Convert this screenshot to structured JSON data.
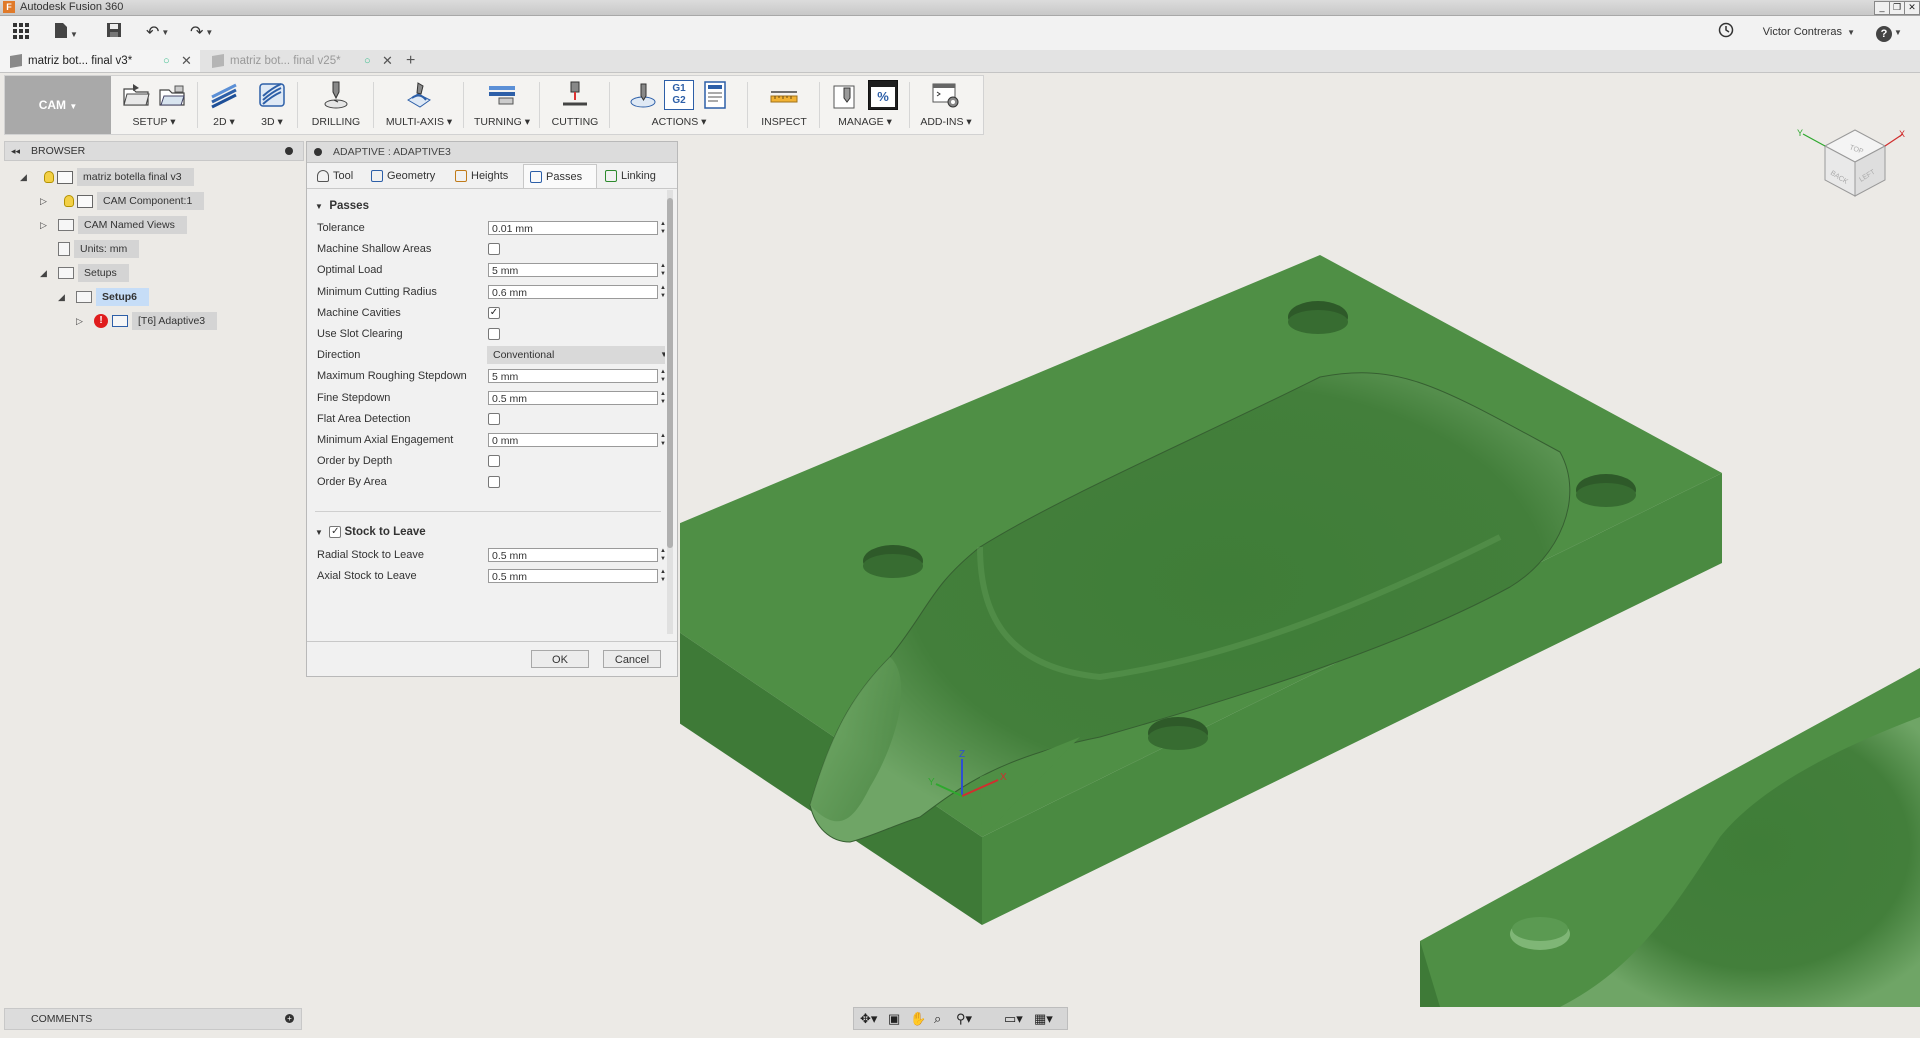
{
  "app": {
    "title": "Autodesk Fusion 360",
    "logo_letter": "F",
    "user": "Victor Contreras",
    "help_label": "?"
  },
  "tabs": [
    {
      "label": "matriz bot... final v3*",
      "active": true
    },
    {
      "label": "matriz bot... final v25*",
      "active": false
    }
  ],
  "ribbon": {
    "workspace": "CAM",
    "groups": [
      {
        "label": "SETUP",
        "caret": true,
        "icons": [
          "setup-folder-icon",
          "setup-sheet-icon"
        ]
      },
      {
        "label": "2D",
        "caret": true,
        "icons": [
          "toolpath-2d-icon"
        ]
      },
      {
        "label": "3D",
        "caret": true,
        "icons": [
          "toolpath-3d-icon"
        ]
      },
      {
        "label": "DRILLING",
        "caret": false,
        "icons": [
          "drill-icon"
        ]
      },
      {
        "label": "MULTI-AXIS",
        "caret": true,
        "icons": [
          "multi-axis-icon"
        ]
      },
      {
        "label": "TURNING",
        "caret": true,
        "icons": [
          "turning-icon"
        ]
      },
      {
        "label": "CUTTING",
        "caret": false,
        "icons": [
          "cutting-icon"
        ]
      },
      {
        "label": "ACTIONS",
        "caret": true,
        "icons": [
          "simulate-icon",
          "post-process-icon",
          "setup-sheet-doc-icon"
        ]
      },
      {
        "label": "INSPECT",
        "caret": false,
        "icons": [
          "measure-icon"
        ]
      },
      {
        "label": "MANAGE",
        "caret": true,
        "icons": [
          "tool-library-icon",
          "post-library-icon"
        ]
      },
      {
        "label": "ADD-INS",
        "caret": true,
        "icons": [
          "scripts-addins-icon"
        ]
      }
    ],
    "gcode_text": [
      "G1",
      "G2"
    ],
    "percent_text": "%"
  },
  "browser": {
    "title": "BROWSER",
    "nodes": [
      {
        "label": "matriz botella final v3"
      },
      {
        "label": "CAM Component:1"
      },
      {
        "label": "CAM Named Views"
      },
      {
        "label": "Units: mm"
      },
      {
        "label": "Setups"
      },
      {
        "label": "Setup6"
      },
      {
        "label": "[T6] Adaptive3"
      }
    ],
    "error_mark": "!"
  },
  "comments": {
    "title": "COMMENTS"
  },
  "dialog": {
    "title": "ADAPTIVE : ADAPTIVE3",
    "tabs": [
      "Tool",
      "Geometry",
      "Heights",
      "Passes",
      "Linking"
    ],
    "passes_section": "Passes",
    "rows": [
      {
        "label": "Tolerance",
        "type": "field",
        "value": "0.01 mm"
      },
      {
        "label": "Machine Shallow Areas",
        "type": "checkbox",
        "checked": false
      },
      {
        "label": "Optimal Load",
        "type": "field",
        "value": "5 mm"
      },
      {
        "label": "Minimum Cutting Radius",
        "type": "field",
        "value": "0.6 mm"
      },
      {
        "label": "Machine Cavities",
        "type": "checkbox",
        "checked": true
      },
      {
        "label": "Use Slot Clearing",
        "type": "checkbox",
        "checked": false
      },
      {
        "label": "Direction",
        "type": "select",
        "value": "Conventional"
      },
      {
        "label": "Maximum Roughing Stepdown",
        "type": "field",
        "value": "5 mm"
      },
      {
        "label": "Fine Stepdown",
        "type": "field",
        "value": "0.5 mm"
      },
      {
        "label": "Flat Area Detection",
        "type": "checkbox",
        "checked": false
      },
      {
        "label": "Minimum Axial Engagement",
        "type": "field",
        "value": "0 mm"
      },
      {
        "label": "Order by Depth",
        "type": "checkbox",
        "checked": false
      },
      {
        "label": "Order By Area",
        "type": "checkbox",
        "checked": false
      }
    ],
    "stock_section": {
      "label": "Stock to Leave",
      "checked": true
    },
    "stock_rows": [
      {
        "label": "Radial Stock to Leave",
        "type": "field",
        "value": "0.5 mm"
      },
      {
        "label": "Axial Stock to Leave",
        "type": "field",
        "value": "0.5 mm"
      }
    ],
    "ok_label": "OK",
    "cancel_label": "Cancel",
    "check_mark": "✓"
  },
  "viewcube": {
    "back": "BACK",
    "left": "LEFT",
    "top": "TOP",
    "axis_x": "X",
    "axis_y": "Y"
  },
  "triad": {
    "x": "X",
    "y": "Y",
    "z": "Z"
  },
  "colors": {
    "model_top": "#4f8f45",
    "model_front": "#3e7a37",
    "model_side": "#4a8a41",
    "accent_select": "#c6ddf7"
  }
}
